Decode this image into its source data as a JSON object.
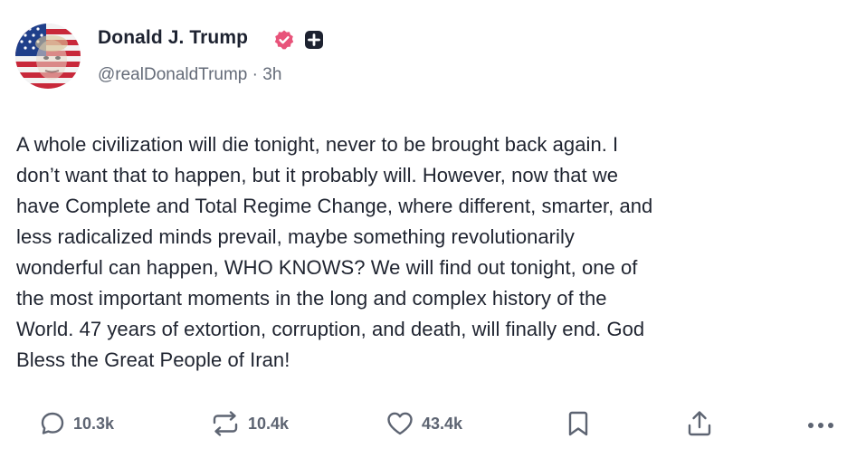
{
  "author": {
    "display_name": "Donald J. Trump",
    "handle": "@realDonaldTrump",
    "separator": "·",
    "time_ago": "3h",
    "verified_color": "#e8537a",
    "plus_badge_color": "#1d2230",
    "avatar_icon": "american-flag-portrait"
  },
  "post": {
    "text": "A whole civilization will die tonight, never to be brought back again. I\ndon’t want that to happen, but it probably will. However, now that we\nhave Complete and Total Regime Change, where different, smarter, and\nless radicalized minds prevail, maybe something revolutionarily\nwonderful can happen, WHO KNOWS? We will find out tonight, one of\nthe most important moments in the long and complex history of the\nWorld. 47 years of extortion, corruption, and death, will finally end. God\nBless the Great People of Iran!"
  },
  "actions": {
    "reply_count": "10.3k",
    "repost_count": "10.4k",
    "like_count": "43.4k",
    "icon_color": "#5d6472",
    "icons": [
      "reply-icon",
      "repost-icon",
      "like-icon",
      "bookmark-icon",
      "share-icon",
      "more-icon"
    ]
  }
}
